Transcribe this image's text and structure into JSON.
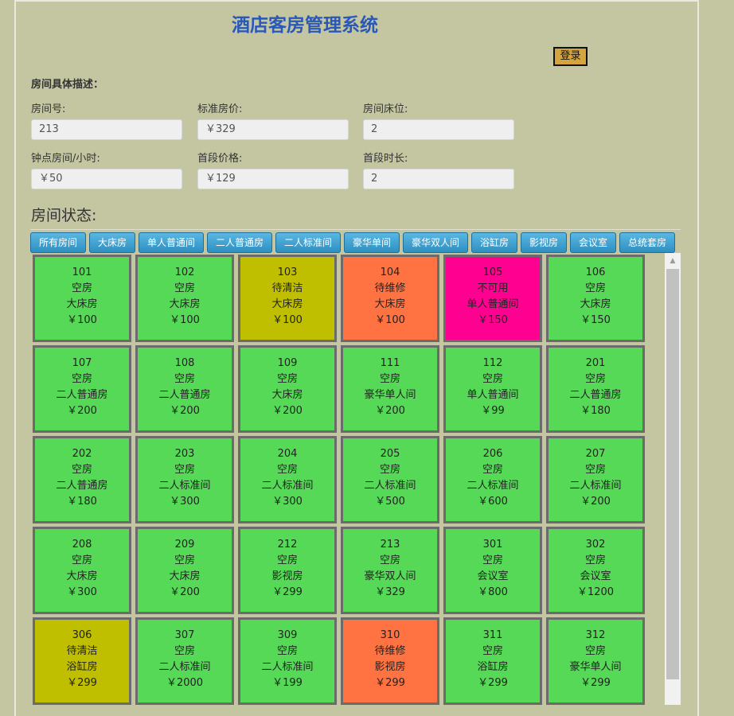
{
  "header": {
    "title": "酒店客房管理系统",
    "login_label": "登录"
  },
  "description": {
    "heading": "房间具体描述：",
    "fields": [
      {
        "label": "房间号:",
        "value": "213"
      },
      {
        "label": "标准房价:",
        "value": "￥329"
      },
      {
        "label": "房间床位:",
        "value": "2"
      },
      {
        "label": "钟点房间/小时:",
        "value": "￥50"
      },
      {
        "label": "首段价格:",
        "value": "￥129"
      },
      {
        "label": "首段时长:",
        "value": "2"
      }
    ]
  },
  "status": {
    "heading": "房间状态:",
    "tabs": [
      "所有房间",
      "大床房",
      "单人普通间",
      "二人普通房",
      "二人标准间",
      "豪华单间",
      "豪华双人间",
      "浴缸房",
      "影视房",
      "会议室",
      "总统套房"
    ]
  },
  "status_colors": {
    "空房": "#56d957",
    "待清洁": "#bfbf00",
    "待维修": "#ff7342",
    "不可用": "#ff0090"
  },
  "rooms": [
    {
      "number": "101",
      "status": "空房",
      "type": "大床房",
      "price": "￥100"
    },
    {
      "number": "102",
      "status": "空房",
      "type": "大床房",
      "price": "￥100"
    },
    {
      "number": "103",
      "status": "待清洁",
      "type": "大床房",
      "price": "￥100"
    },
    {
      "number": "104",
      "status": "待维修",
      "type": "大床房",
      "price": "￥100"
    },
    {
      "number": "105",
      "status": "不可用",
      "type": "单人普通间",
      "price": "￥150"
    },
    {
      "number": "106",
      "status": "空房",
      "type": "大床房",
      "price": "￥150"
    },
    {
      "number": "107",
      "status": "空房",
      "type": "二人普通房",
      "price": "￥200"
    },
    {
      "number": "108",
      "status": "空房",
      "type": "二人普通房",
      "price": "￥200"
    },
    {
      "number": "109",
      "status": "空房",
      "type": "大床房",
      "price": "￥200"
    },
    {
      "number": "111",
      "status": "空房",
      "type": "豪华单人间",
      "price": "￥200"
    },
    {
      "number": "112",
      "status": "空房",
      "type": "单人普通间",
      "price": "￥99"
    },
    {
      "number": "201",
      "status": "空房",
      "type": "二人普通房",
      "price": "￥180"
    },
    {
      "number": "202",
      "status": "空房",
      "type": "二人普通房",
      "price": "￥180"
    },
    {
      "number": "203",
      "status": "空房",
      "type": "二人标准间",
      "price": "￥300"
    },
    {
      "number": "204",
      "status": "空房",
      "type": "二人标准间",
      "price": "￥300"
    },
    {
      "number": "205",
      "status": "空房",
      "type": "二人标准间",
      "price": "￥500"
    },
    {
      "number": "206",
      "status": "空房",
      "type": "二人标准间",
      "price": "￥600"
    },
    {
      "number": "207",
      "status": "空房",
      "type": "二人标准间",
      "price": "￥200"
    },
    {
      "number": "208",
      "status": "空房",
      "type": "大床房",
      "price": "￥300"
    },
    {
      "number": "209",
      "status": "空房",
      "type": "大床房",
      "price": "￥200"
    },
    {
      "number": "212",
      "status": "空房",
      "type": "影视房",
      "price": "￥299"
    },
    {
      "number": "213",
      "status": "空房",
      "type": "豪华双人间",
      "price": "￥329"
    },
    {
      "number": "301",
      "status": "空房",
      "type": "会议室",
      "price": "￥800"
    },
    {
      "number": "302",
      "status": "空房",
      "type": "会议室",
      "price": "￥1200"
    },
    {
      "number": "306",
      "status": "待清洁",
      "type": "浴缸房",
      "price": "￥299"
    },
    {
      "number": "307",
      "status": "空房",
      "type": "二人标准间",
      "price": "￥2000"
    },
    {
      "number": "309",
      "status": "空房",
      "type": "二人标准间",
      "price": "￥199"
    },
    {
      "number": "310",
      "status": "待维修",
      "type": "影视房",
      "price": "￥299"
    },
    {
      "number": "311",
      "status": "空房",
      "type": "浴缸房",
      "price": "￥299"
    },
    {
      "number": "312",
      "status": "空房",
      "type": "豪华单人间",
      "price": "￥299"
    }
  ]
}
